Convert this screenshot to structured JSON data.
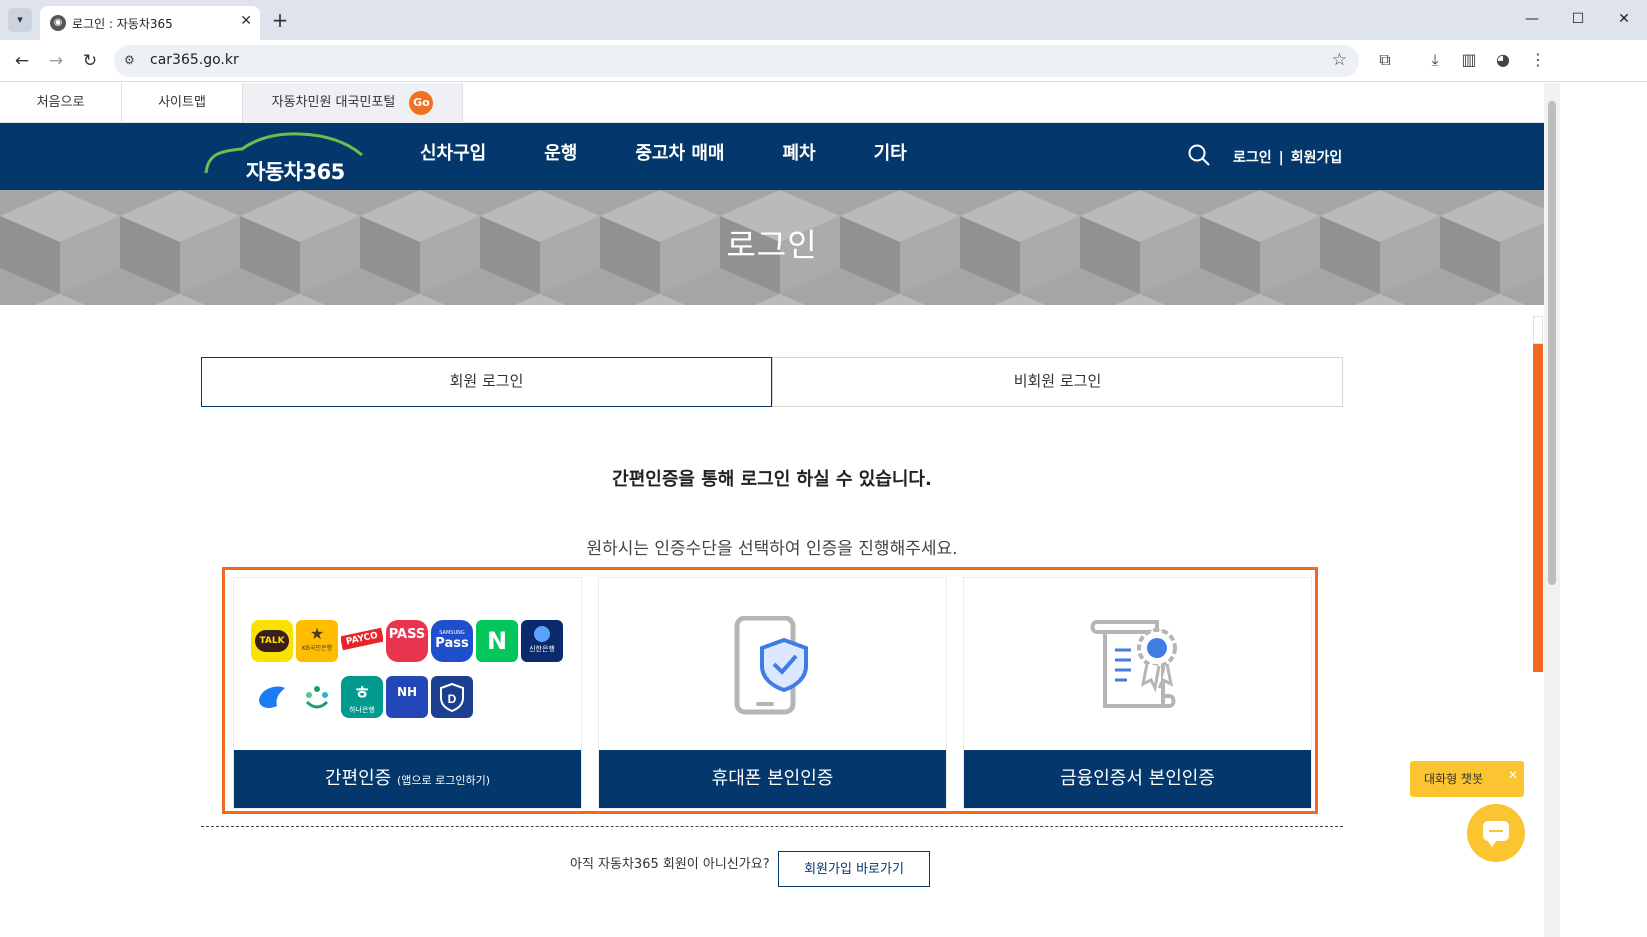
{
  "browser": {
    "tab_title": "로그인 : 자동차365",
    "url": "car365.go.kr"
  },
  "util_bar": {
    "home": "처음으로",
    "sitemap": "사이트맵",
    "portal": "자동차민원 대국민포털",
    "go": "Go"
  },
  "header": {
    "logo": "자동차365",
    "menu": [
      "신차구입",
      "운행",
      "중고차 매매",
      "폐차",
      "기타"
    ],
    "login": "로그인",
    "separator": "|",
    "signup": "회원가입"
  },
  "hero": {
    "title": "로그인"
  },
  "login_tabs": {
    "member": "회원 로그인",
    "guest": "비회원 로그인"
  },
  "lead": "간편인증을 통해 로그인 하실 수 있습니다.",
  "sub": "원하시는 인증수단을 선택하여 인증을 진행해주세요.",
  "options": {
    "simple_label": "간편인증",
    "simple_note": "(앱으로 로그인하기)",
    "phone_label": "휴대폰 본인인증",
    "cert_label": "금융인증서 본인인증"
  },
  "apps": {
    "kakao": "TALK",
    "kb": "KB국민은행",
    "payco": "PAYCO",
    "pass": "PASS",
    "samsung_top": "SAMSUNG",
    "samsung": "Pass",
    "naver": "N",
    "shinhan": "신한은행",
    "hana": "하나은행",
    "nh": "NH"
  },
  "join": {
    "question": "아직 자동차365 회원이 아니신가요?",
    "button": "회원가입 바로가기"
  },
  "chatbot": {
    "tip": "대화형 챗봇",
    "close": "✕"
  },
  "colors": {
    "navy": "#04376b",
    "orange": "#f26a21",
    "chatbot": "#fbc531"
  }
}
